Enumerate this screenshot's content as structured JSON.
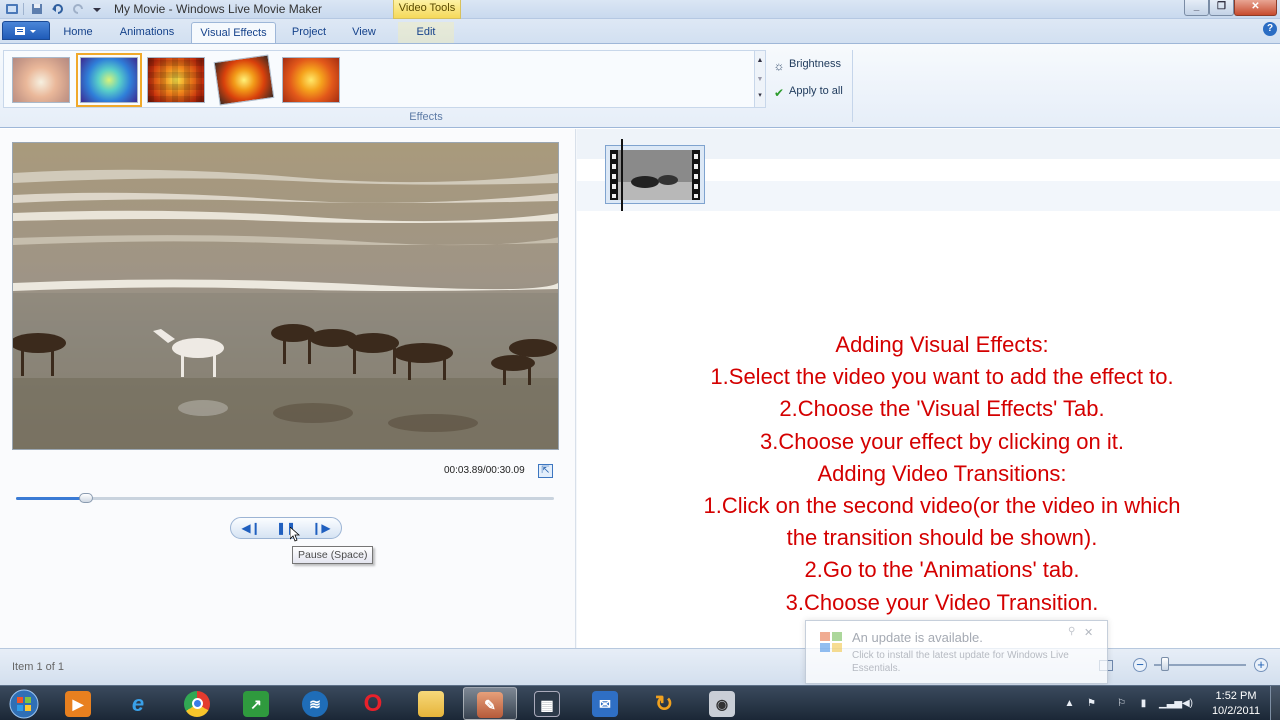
{
  "window": {
    "title": "My Movie - Windows Live Movie Maker",
    "context_tab_header": "Video Tools"
  },
  "ribbon": {
    "tabs": [
      {
        "label": "Home",
        "active": false
      },
      {
        "label": "Animations",
        "active": false
      },
      {
        "label": "Visual Effects",
        "active": true
      },
      {
        "label": "Project",
        "active": false
      },
      {
        "label": "View",
        "active": false
      },
      {
        "label": "Edit",
        "active": false
      }
    ],
    "effects_group_label": "Effects",
    "brightness_label": "Brightness",
    "apply_to_all_label": "Apply to all",
    "gallery": [
      {
        "name": "effect-thumb-1",
        "selected": false
      },
      {
        "name": "effect-thumb-2",
        "selected": true
      },
      {
        "name": "effect-thumb-3",
        "selected": false
      },
      {
        "name": "effect-thumb-4",
        "selected": false
      },
      {
        "name": "effect-thumb-5",
        "selected": false
      }
    ],
    "icons": [
      "sun-icon",
      "apply-check-icon",
      "help-icon"
    ]
  },
  "preview": {
    "time_display": "00:03.89/00:30.09",
    "seek_progress": 0.13,
    "tooltip": "Pause (Space)",
    "controls": [
      "previous-frame-icon",
      "pause-icon",
      "next-frame-icon",
      "fullscreen-icon"
    ]
  },
  "instructions": {
    "lines": [
      "Adding Visual Effects:",
      "1.Select the video you want to add the effect to.",
      "2.Choose the 'Visual Effects' Tab.",
      "3.Choose your effect by clicking on it.",
      "Adding Video Transitions:",
      "1.Click on the second video(or the video in which",
      "the transition should be shown).",
      "2.Go to the 'Animations' tab.",
      "3.Choose your Video Transition."
    ],
    "color": "#d40000"
  },
  "status": {
    "item_text": "Item 1 of 1",
    "zoom_level": 0.12
  },
  "update_popup": {
    "title": "An update is available.",
    "body": "Click to install the latest update for Windows Live Essentials."
  },
  "taskbar": {
    "apps": [
      "media-player-icon",
      "internet-explorer-icon",
      "chrome-icon",
      "stock-chart-icon",
      "network-icon",
      "opera-icon",
      "folder-icon",
      "movie-maker-icon",
      "film-icon",
      "outlook-icon",
      "refresh-arrow-icon",
      "camera-icon"
    ],
    "clock_time": "1:52 PM",
    "clock_date": "10/2/2011"
  }
}
